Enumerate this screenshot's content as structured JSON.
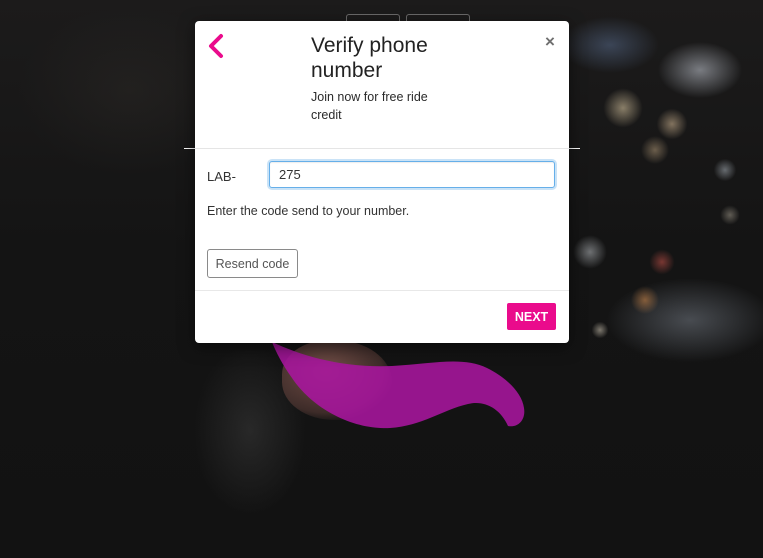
{
  "dialog": {
    "title": "Verify phone number",
    "subtitle": "Join now for free ride credit",
    "back_icon": "chevron-left-icon",
    "close_symbol": "×",
    "close_icon": "close-icon"
  },
  "form": {
    "code_label": "LAB-",
    "code_value": "275",
    "help_text": "Enter the code send to your number.",
    "resend_label": "Resend code"
  },
  "footer": {
    "next_label": "NEXT"
  },
  "colors": {
    "accent": "#ea0b8c",
    "focus_border": "#66afe9",
    "title_text": "#222222"
  }
}
